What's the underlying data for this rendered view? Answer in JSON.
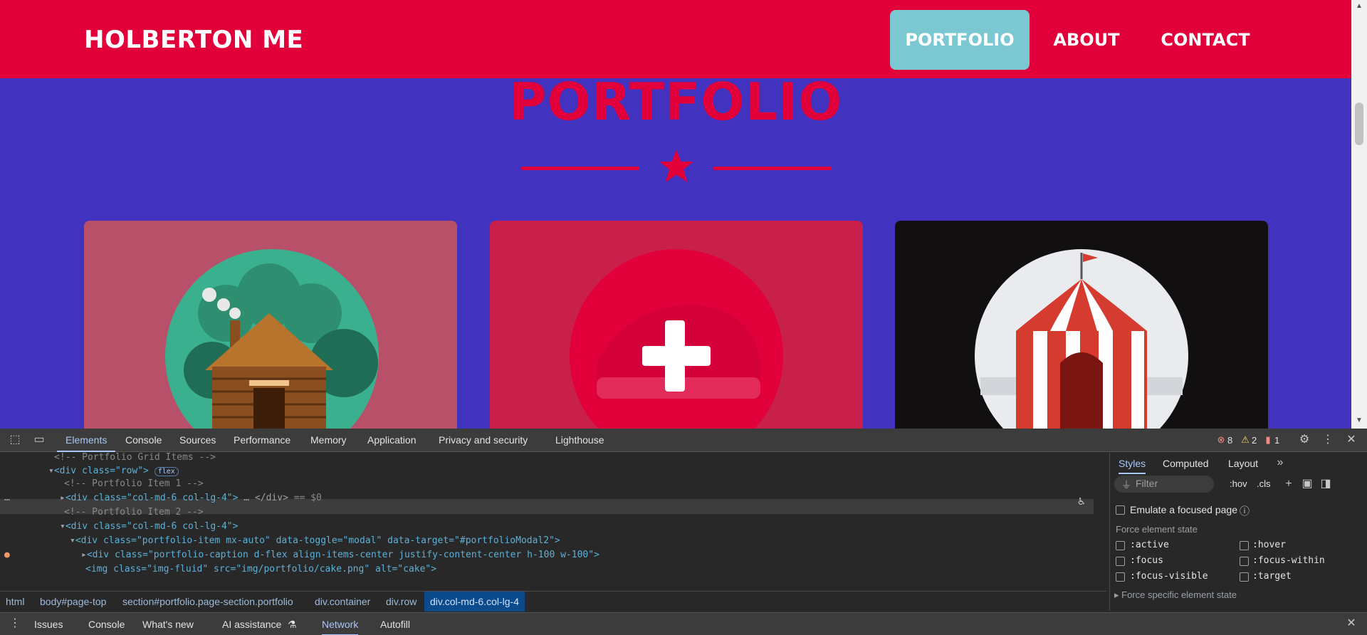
{
  "site": {
    "brand": "HOLBERTON ME",
    "nav": [
      "PORTFOLIO",
      "ABOUT",
      "CONTACT"
    ],
    "section_title": "PORTFOLIO",
    "cards": [
      {
        "name": "portfolio-item-cabin",
        "bg": "#b9506a"
      },
      {
        "name": "portfolio-item-cake",
        "bg": "#c81f4b"
      },
      {
        "name": "portfolio-item-circus",
        "bg": "#120f10"
      }
    ],
    "colors": {
      "primary": "#e1003a",
      "secondary": "#4132bf",
      "active_nav": "#7bc8d2"
    }
  },
  "devtools": {
    "tabs": [
      "Elements",
      "Console",
      "Sources",
      "Performance",
      "Memory",
      "Application",
      "Privacy and security",
      "Lighthouse"
    ],
    "errors": "8",
    "warnings": "2",
    "info": "1",
    "tree": [
      "<!-- Portfolio Grid Items -->",
      "<div class=\"row\">",
      "<!-- Portfolio Item 1 -->",
      "<div class=\"col-md-6 col-lg-4\">",
      "<!-- Portfolio Item 2 -->",
      "<div class=\"col-md-6 col-lg-4\">",
      "<div class=\"portfolio-item mx-auto\" data-toggle=\"modal\" data-target=\"#portfolioModal2\">",
      "<div class=\"portfolio-caption d-flex align-items-center justify-content-center h-100 w-100\">",
      "<img class=\"img-fluid\" src=\"img/portfolio/cake.png\" alt=\"cake\">"
    ],
    "badge_flex": "flex",
    "selected_suffix": "== $0",
    "breadcrumb": [
      "html",
      "body#page-top",
      "section#portfolio.page-section.portfolio",
      "div.container",
      "div.row",
      "div.col-md-6.col-lg-4"
    ],
    "styles_tabs": [
      "Styles",
      "Computed",
      "Layout"
    ],
    "filter_placeholder": "Filter",
    "hov": ":hov",
    "cls": ".cls",
    "emulate_focus": "Emulate a focused page",
    "force_state_title": "Force element state",
    "states": [
      ":active",
      ":hover",
      ":focus",
      ":focus-within",
      ":focus-visible",
      ":target"
    ],
    "force_specific": "Force specific element state",
    "drawer_tabs": [
      "Issues",
      "Console",
      "What's new",
      "AI assistance",
      "Network",
      "Autofill"
    ]
  }
}
